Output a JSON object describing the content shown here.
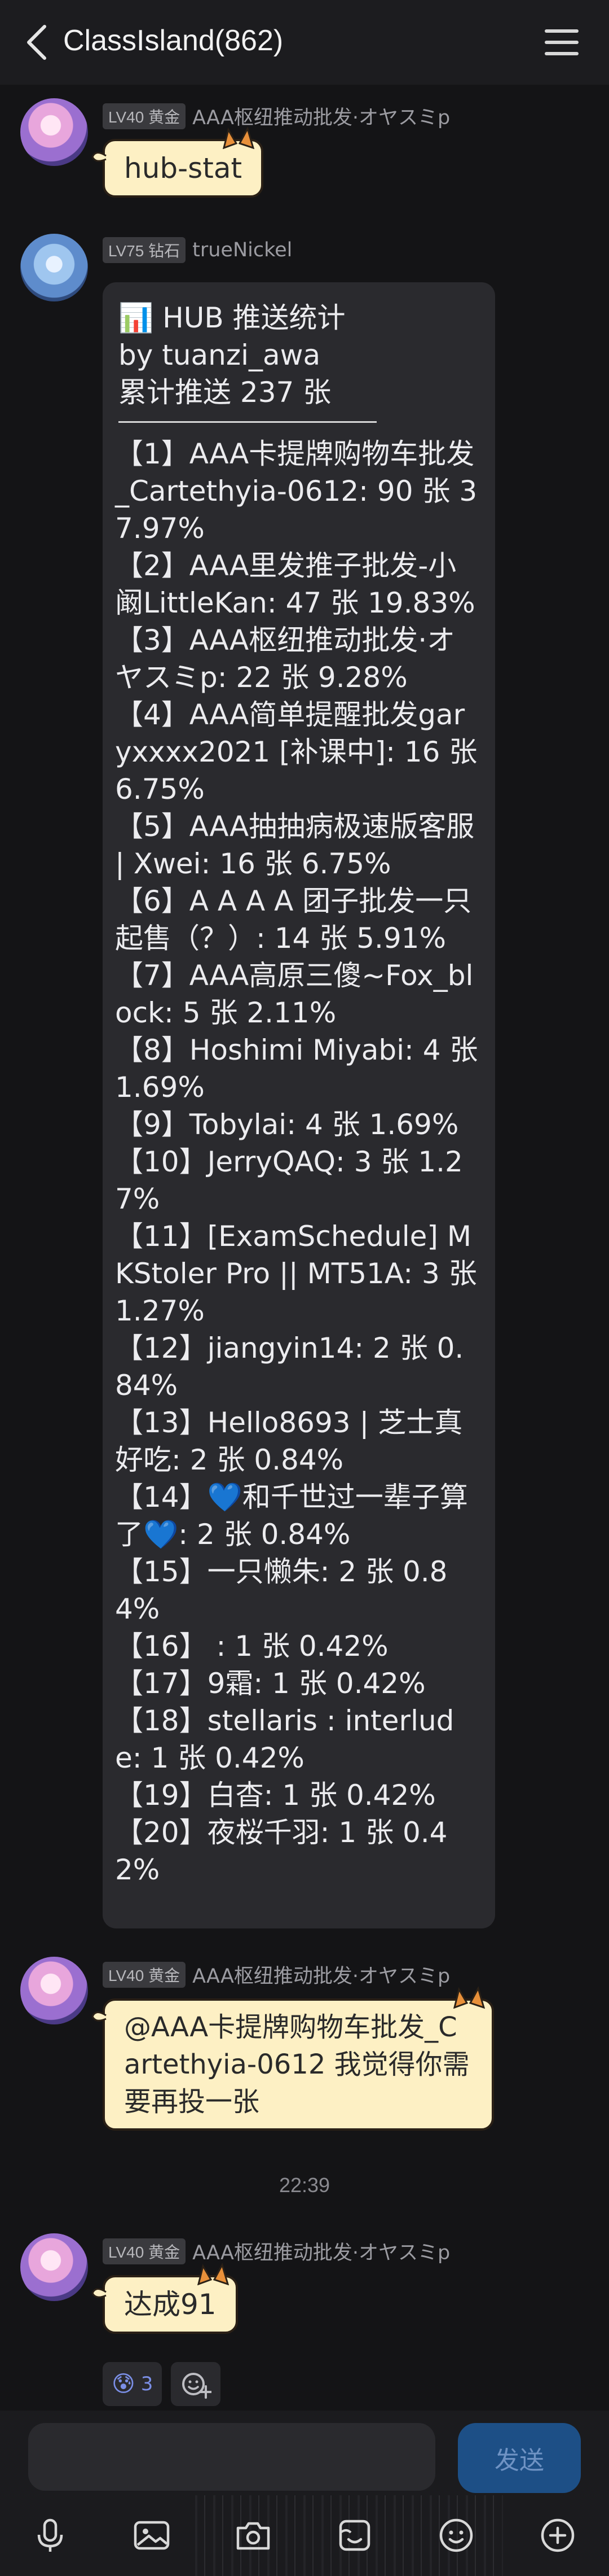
{
  "header": {
    "title": "ClassIsland(862)",
    "back_icon": "chevron-left-icon",
    "menu_icon": "hamburger-menu-icon"
  },
  "messages": [
    {
      "level": "LV40 黄金",
      "sender": "AAA枢纽推动批发·オヤスミp",
      "text": "hub-stat",
      "bubble": "cat"
    },
    {
      "level": "LV75 钻石",
      "sender": "trueNickel",
      "bubble": "dark",
      "header_lines": [
        "📊 HUB 推送统计",
        "by tuanzi_awa",
        "累计推送 237 张"
      ],
      "items": [
        "【1】AAA卡提牌购物车批发_Cartethyia-0612: 90 张 37.97%",
        "【2】AAA里发推子批发-小阚LittleKan: 47 张 19.83%",
        "【3】AAA枢纽推动批发·オヤスミp: 22 张 9.28%",
        "【4】AAA简单提醒批发garyxxxx2021 [补课中]: 16 张 6.75%",
        "【5】AAA抽抽病极速版客服 | Xwei: 16 张 6.75%",
        "【6】A A A A 团子批发一只起售（？）: 14 张 5.91%",
        "【7】AAA高原三傻~Fox_block: 5 张 2.11%",
        "【8】Hoshimi Miyabi: 4 张 1.69%",
        "【9】Tobylai: 4 张 1.69%",
        "【10】JerryQAQ: 3 张 1.27%",
        "【11】[ExamSchedule] MKStoler Pro || MT51A: 3 张 1.27%",
        "【12】jiangyin14: 2 张 0.84%",
        "【13】Hello8693 | 芝士真好吃: 2 张 0.84%",
        "【14】💙和千世过一辈子算了💙: 2 张 0.84%",
        "【15】一只懒朱: 2 张 0.84%",
        "【16】          : 1 张 0.42%",
        "【17】9霜: 1 张 0.42%",
        "【18】stellaris : interlude: 1 张 0.42%",
        "【19】白杳: 1 张 0.42%",
        "【20】夜桜千羽: 1 张 0.42%"
      ]
    },
    {
      "level": "LV40 黄金",
      "sender": "AAA枢纽推动批发·オヤスミp",
      "text": "@AAA卡提牌购物车批发_Cartethyia-0612 我觉得你需要再投一张",
      "bubble": "cat"
    },
    {
      "timestamp": "22:39"
    },
    {
      "level": "LV40 黄金",
      "sender": "AAA枢纽推动批发·オヤスミp",
      "text": "达成91",
      "bubble": "cat",
      "reactions": [
        {
          "emoji": "😰",
          "count": "3"
        },
        {
          "icon": "add-reaction-icon"
        }
      ]
    }
  ],
  "input": {
    "placeholder": "",
    "value": "",
    "send_label": "发送"
  },
  "toolbar": {
    "icons": [
      "microphone-icon",
      "image-icon",
      "camera-icon",
      "sticker-icon",
      "emoji-icon",
      "plus-icon"
    ]
  },
  "colors": {
    "background": "#141416",
    "cat_bubble": "#fdf0c4",
    "dark_bubble": "#2a2a2e",
    "send_button": "#1d4f86",
    "reaction_count": "#7b8fe6"
  }
}
